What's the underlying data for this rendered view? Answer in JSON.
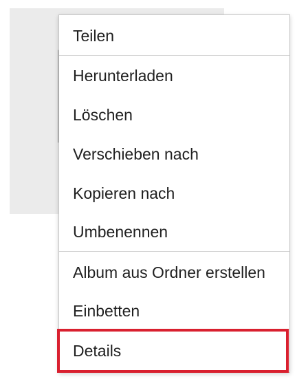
{
  "menu": {
    "items": [
      {
        "id": "share",
        "label": "Teilen"
      },
      {
        "id": "download",
        "label": "Herunterladen"
      },
      {
        "id": "delete",
        "label": "Löschen"
      },
      {
        "id": "move-to",
        "label": "Verschieben nach"
      },
      {
        "id": "copy-to",
        "label": "Kopieren nach"
      },
      {
        "id": "rename",
        "label": "Umbenennen"
      },
      {
        "id": "create-album",
        "label": "Album aus Ordner erstellen"
      },
      {
        "id": "embed",
        "label": "Einbetten"
      },
      {
        "id": "details",
        "label": "Details"
      }
    ],
    "highlighted_item": "details"
  },
  "colors": {
    "highlight_border": "#d9202f",
    "tile_background": "#ebebeb",
    "folder_icon": "#8f8f8f"
  },
  "icons": {
    "folder": "folder-icon"
  }
}
